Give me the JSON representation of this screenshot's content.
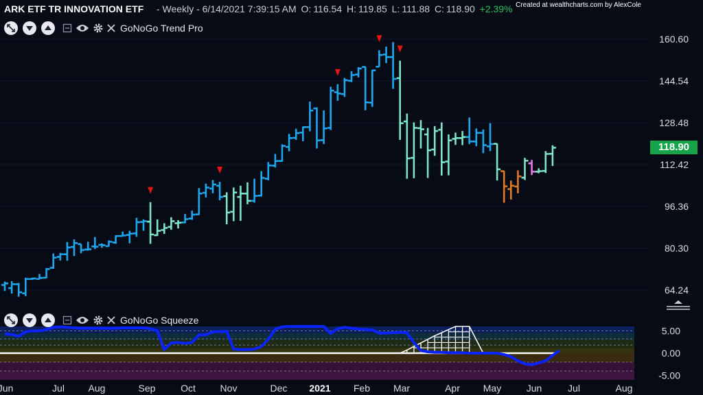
{
  "header": {
    "title": "ARK ETF TR INNOVATION ETF",
    "period": "- Weekly - 6/14/2021 7:39:15 AM",
    "open_label": "O:",
    "open": "116.54",
    "high_label": "H:",
    "high": "119.85",
    "low_label": "L:",
    "low": "111.88",
    "close_label": "C:",
    "close": "118.90",
    "change": "+2.39%"
  },
  "credit": "Created at wealthcharts.com by AlexCole",
  "main_panel": {
    "study_name": "GoNoGo Trend Pro",
    "last_price": "118.90",
    "icons": [
      "expand-icon",
      "chevron-down-icon",
      "chevron-up-icon",
      "minimize-icon",
      "eye-icon",
      "gear-icon",
      "close-icon"
    ]
  },
  "osc_panel": {
    "study_name": "GoNoGo Squeeze",
    "icons": [
      "expand-icon",
      "chevron-down-icon",
      "chevron-up-icon",
      "minimize-icon",
      "eye-icon",
      "gear-icon",
      "close-icon"
    ]
  },
  "colors": {
    "background": "#070b15",
    "go_strong": "#1ea7ef",
    "go_weak": "#7de6c8",
    "nogo_weak": "#e877e8",
    "nogo_strong": "#e07b22",
    "countertrend": "#e81414",
    "oscillator": "#0b23ff",
    "price_badge": "#16a34a"
  },
  "chart_data": [
    {
      "type": "ohlc",
      "title": "GoNoGo Trend Pro",
      "y_ticks": [
        "160.60",
        "144.54",
        "128.48",
        "112.42",
        "96.36",
        "80.30",
        "64.24"
      ],
      "ylim": [
        59.5,
        164.5
      ],
      "x_ticks": [
        {
          "label": "Jun",
          "bold": false
        },
        {
          "label": "Jul",
          "bold": false
        },
        {
          "label": "Aug",
          "bold": false
        },
        {
          "label": "Sep",
          "bold": false
        },
        {
          "label": "Oct",
          "bold": false
        },
        {
          "label": "Nov",
          "bold": false
        },
        {
          "label": "Dec",
          "bold": false
        },
        {
          "label": "2021",
          "bold": true
        },
        {
          "label": "Feb",
          "bold": false
        },
        {
          "label": "Mar",
          "bold": false
        },
        {
          "label": "Apr",
          "bold": false
        },
        {
          "label": "May",
          "bold": false
        },
        {
          "label": "Jun",
          "bold": false
        },
        {
          "label": "Jul",
          "bold": false
        },
        {
          "label": "Aug",
          "bold": false
        }
      ],
      "bars": [
        {
          "o": 66.2,
          "h": 67.5,
          "l": 63.9,
          "c": 66.8,
          "g": "go_strong"
        },
        {
          "o": 65.0,
          "h": 67.7,
          "l": 62.9,
          "c": 66.5,
          "g": "go_strong"
        },
        {
          "o": 66.5,
          "h": 67.0,
          "l": 61.7,
          "c": 63.4,
          "g": "go_strong"
        },
        {
          "o": 63.0,
          "h": 69.0,
          "l": 61.9,
          "c": 68.5,
          "g": "go_strong"
        },
        {
          "o": 68.5,
          "h": 69.0,
          "l": 68.2,
          "c": 68.7,
          "g": "go_strong"
        },
        {
          "o": 68.5,
          "h": 70.4,
          "l": 68.4,
          "c": 68.9,
          "g": "go_strong"
        },
        {
          "o": 69.0,
          "h": 72.7,
          "l": 68.8,
          "c": 72.3,
          "g": "go_strong"
        },
        {
          "o": 72.8,
          "h": 78.3,
          "l": 72.4,
          "c": 76.7,
          "g": "go_strong"
        },
        {
          "o": 77.0,
          "h": 78.5,
          "l": 75.6,
          "c": 78.0,
          "g": "go_strong"
        },
        {
          "o": 78.0,
          "h": 82.7,
          "l": 75.5,
          "c": 80.6,
          "g": "go_strong"
        },
        {
          "o": 80.8,
          "h": 83.7,
          "l": 77.3,
          "c": 82.3,
          "g": "go_strong"
        },
        {
          "o": 81.9,
          "h": 81.9,
          "l": 78.4,
          "c": 79.6,
          "g": "go_strong"
        },
        {
          "o": 79.8,
          "h": 82.8,
          "l": 79.4,
          "c": 79.9,
          "g": "go_strong"
        },
        {
          "o": 81.0,
          "h": 84.6,
          "l": 80.0,
          "c": 80.9,
          "g": "go_strong"
        },
        {
          "o": 81.6,
          "h": 82.2,
          "l": 80.5,
          "c": 81.5,
          "g": "go_strong"
        },
        {
          "o": 81.1,
          "h": 83.3,
          "l": 81.0,
          "c": 82.8,
          "g": "go_strong"
        },
        {
          "o": 82.5,
          "h": 85.3,
          "l": 82.0,
          "c": 85.0,
          "g": "go_strong"
        },
        {
          "o": 85.0,
          "h": 86.7,
          "l": 85.0,
          "c": 85.2,
          "g": "go_strong"
        },
        {
          "o": 85.4,
          "h": 87.0,
          "l": 82.2,
          "c": 85.9,
          "g": "go_strong"
        },
        {
          "o": 86.0,
          "h": 92.0,
          "l": 84.7,
          "c": 90.3,
          "g": "go_strong"
        },
        {
          "o": 90.4,
          "h": 91.4,
          "l": 87.0,
          "c": 90.7,
          "g": "go_strong"
        },
        {
          "o": 90.5,
          "h": 98.0,
          "l": 82.0,
          "c": 85.6,
          "g": "go_weak"
        },
        {
          "o": 85.3,
          "h": 91.4,
          "l": 85.0,
          "c": 87.0,
          "g": "go_weak"
        },
        {
          "o": 87.3,
          "h": 89.9,
          "l": 85.8,
          "c": 88.1,
          "g": "go_weak"
        },
        {
          "o": 88.5,
          "h": 92.2,
          "l": 87.4,
          "c": 90.7,
          "g": "go_weak"
        },
        {
          "o": 89.9,
          "h": 91.1,
          "l": 87.9,
          "c": 90.1,
          "g": "go_weak"
        },
        {
          "o": 90.2,
          "h": 93.5,
          "l": 89.9,
          "c": 91.5,
          "g": "go_strong"
        },
        {
          "o": 91.7,
          "h": 94.7,
          "l": 91.2,
          "c": 93.2,
          "g": "go_strong"
        },
        {
          "o": 93.3,
          "h": 103.4,
          "l": 93.1,
          "c": 101.3,
          "g": "go_strong"
        },
        {
          "o": 101.6,
          "h": 105.1,
          "l": 99.8,
          "c": 103.6,
          "g": "go_strong"
        },
        {
          "o": 103.2,
          "h": 106.5,
          "l": 101.4,
          "c": 104.8,
          "g": "go_strong"
        },
        {
          "o": 104.3,
          "h": 105.8,
          "l": 98.7,
          "c": 100.0,
          "g": "go_strong"
        },
        {
          "o": 100.3,
          "h": 101.8,
          "l": 89.5,
          "c": 94.0,
          "g": "go_weak"
        },
        {
          "o": 94.3,
          "h": 103.6,
          "l": 90.7,
          "c": 101.7,
          "g": "go_weak"
        },
        {
          "o": 100.0,
          "h": 104.3,
          "l": 90.8,
          "c": 101.3,
          "g": "go_weak"
        },
        {
          "o": 101.3,
          "h": 105.6,
          "l": 97.2,
          "c": 98.5,
          "g": "go_weak"
        },
        {
          "o": 98.5,
          "h": 107.0,
          "l": 97.8,
          "c": 100.4,
          "g": "go_strong"
        },
        {
          "o": 100.5,
          "h": 109.9,
          "l": 100.2,
          "c": 107.3,
          "g": "go_strong"
        },
        {
          "o": 107.0,
          "h": 113.4,
          "l": 106.4,
          "c": 112.1,
          "g": "go_strong"
        },
        {
          "o": 112.0,
          "h": 116.5,
          "l": 111.3,
          "c": 113.8,
          "g": "go_strong"
        },
        {
          "o": 113.8,
          "h": 120.2,
          "l": 113.5,
          "c": 119.6,
          "g": "go_strong"
        },
        {
          "o": 119.2,
          "h": 124.2,
          "l": 117.5,
          "c": 122.6,
          "g": "go_strong"
        },
        {
          "o": 122.7,
          "h": 126.2,
          "l": 121.9,
          "c": 124.5,
          "g": "go_strong"
        },
        {
          "o": 124.7,
          "h": 127.0,
          "l": 121.4,
          "c": 126.8,
          "g": "go_strong"
        },
        {
          "o": 126.8,
          "h": 136.6,
          "l": 125.2,
          "c": 133.2,
          "g": "go_strong"
        },
        {
          "o": 134.0,
          "h": 134.4,
          "l": 118.6,
          "c": 121.7,
          "g": "go_strong"
        },
        {
          "o": 121.8,
          "h": 133.2,
          "l": 120.3,
          "c": 126.3,
          "g": "go_strong"
        },
        {
          "o": 126.5,
          "h": 142.3,
          "l": 125.7,
          "c": 140.8,
          "g": "go_strong"
        },
        {
          "o": 140.2,
          "h": 143.3,
          "l": 136.9,
          "c": 139.7,
          "g": "go_strong"
        },
        {
          "o": 139.5,
          "h": 145.7,
          "l": 138.4,
          "c": 144.8,
          "g": "go_strong"
        },
        {
          "o": 144.6,
          "h": 148.3,
          "l": 144.1,
          "c": 146.8,
          "g": "go_strong"
        },
        {
          "o": 147.0,
          "h": 149.8,
          "l": 145.9,
          "c": 149.3,
          "g": "go_strong"
        },
        {
          "o": 149.9,
          "h": 150.1,
          "l": 133.3,
          "c": 136.3,
          "g": "go_strong"
        },
        {
          "o": 136.2,
          "h": 148.8,
          "l": 134.6,
          "c": 148.6,
          "g": "go_strong"
        },
        {
          "o": 150.0,
          "h": 156.3,
          "l": 150.0,
          "c": 154.5,
          "g": "go_strong"
        },
        {
          "o": 154.7,
          "h": 157.7,
          "l": 151.4,
          "c": 153.7,
          "g": "go_strong"
        },
        {
          "o": 153.7,
          "h": 159.4,
          "l": 141.5,
          "c": 145.3,
          "g": "go_strong"
        },
        {
          "o": 145.6,
          "h": 152.3,
          "l": 121.9,
          "c": 128.3,
          "g": "go_weak"
        },
        {
          "o": 129.0,
          "h": 132.0,
          "l": 107.0,
          "c": 114.8,
          "g": "go_weak"
        },
        {
          "o": 115.0,
          "h": 128.6,
          "l": 107.2,
          "c": 126.5,
          "g": "go_weak"
        },
        {
          "o": 126.4,
          "h": 129.5,
          "l": 118.6,
          "c": 126.0,
          "g": "go_weak"
        },
        {
          "o": 124.0,
          "h": 126.5,
          "l": 107.3,
          "c": 117.9,
          "g": "go_weak"
        },
        {
          "o": 118.2,
          "h": 127.2,
          "l": 115.8,
          "c": 125.3,
          "g": "go_weak"
        },
        {
          "o": 125.8,
          "h": 128.6,
          "l": 108.2,
          "c": 113.3,
          "g": "go_weak"
        },
        {
          "o": 113.6,
          "h": 124.0,
          "l": 108.3,
          "c": 121.7,
          "g": "go_weak"
        },
        {
          "o": 122.3,
          "h": 124.7,
          "l": 120.0,
          "c": 122.6,
          "g": "go_weak"
        },
        {
          "o": 122.6,
          "h": 125.3,
          "l": 119.9,
          "c": 123.0,
          "g": "go_weak"
        },
        {
          "o": 123.0,
          "h": 130.5,
          "l": 120.3,
          "c": 121.3,
          "g": "go_strong"
        },
        {
          "o": 121.3,
          "h": 126.3,
          "l": 119.5,
          "c": 124.6,
          "g": "go_strong"
        },
        {
          "o": 124.6,
          "h": 125.9,
          "l": 116.8,
          "c": 119.9,
          "g": "go_strong"
        },
        {
          "o": 119.4,
          "h": 128.3,
          "l": 117.6,
          "c": 120.3,
          "g": "go_strong"
        },
        {
          "o": 120.4,
          "h": 120.5,
          "l": 106.3,
          "c": 110.6,
          "g": "go_weak"
        },
        {
          "o": 109.9,
          "h": 110.0,
          "l": 97.8,
          "c": 104.1,
          "g": "nogo_strong"
        },
        {
          "o": 103.0,
          "h": 106.3,
          "l": 99.0,
          "c": 104.3,
          "g": "nogo_strong"
        },
        {
          "o": 104.0,
          "h": 110.2,
          "l": 101.4,
          "c": 107.9,
          "g": "nogo_strong"
        },
        {
          "o": 107.4,
          "h": 115.0,
          "l": 106.5,
          "c": 113.9,
          "g": "go_weak"
        },
        {
          "o": 112.9,
          "h": 114.2,
          "l": 108.4,
          "c": 109.7,
          "g": "nogo_weak"
        },
        {
          "o": 109.7,
          "h": 111.0,
          "l": 109.1,
          "c": 109.9,
          "g": "go_weak"
        },
        {
          "o": 110.0,
          "h": 117.6,
          "l": 109.2,
          "c": 116.5,
          "g": "go_weak"
        },
        {
          "o": 116.54,
          "h": 119.85,
          "l": 111.88,
          "c": 118.9,
          "g": "go_weak"
        }
      ],
      "countertrend_bars": [
        21,
        31,
        48,
        54,
        57
      ]
    },
    {
      "type": "area",
      "title": "GoNoGo Squeeze",
      "y_ticks": [
        "5.00",
        "0.00",
        "-5.00"
      ],
      "ylim": [
        -6.0,
        6.0
      ],
      "series": [
        {
          "name": "",
          "values": [
            4.3,
            4.2,
            3.8,
            4.8,
            5.0,
            5.0,
            5.3,
            5.8,
            5.9,
            5.8,
            5.7,
            5.6,
            5.6,
            5.6,
            5.6,
            5.6,
            5.6,
            5.7,
            5.7,
            5.7,
            5.7,
            5.5,
            5.0,
            0.8,
            2.3,
            2.4,
            2.2,
            2.4,
            4.1,
            4.1,
            4.8,
            4.8,
            4.9,
            0.9,
            0.8,
            0.8,
            0.9,
            1.5,
            3.1,
            5.4,
            5.9,
            6.0,
            6.0,
            6.0,
            6.0,
            6.0,
            6.0,
            4.4,
            5.5,
            5.8,
            5.6,
            5.4,
            5.3,
            5.2,
            4.5,
            4.5,
            4.6,
            4.7,
            4.6,
            2.4,
            0.6,
            0.3,
            0.2,
            0.2,
            0.1,
            0.1,
            0.1,
            0.0,
            0.0,
            0.0,
            0.0,
            0.0,
            -0.3,
            -0.8,
            -1.7,
            -2.4,
            -2.6,
            -2.2,
            -1.7,
            -0.5,
            0.6
          ]
        }
      ],
      "grid_climb": [
        0.7,
        1.5,
        2.3,
        3.1,
        3.9,
        4.6,
        5.3,
        6.0,
        6.0,
        6.0
      ]
    }
  ]
}
